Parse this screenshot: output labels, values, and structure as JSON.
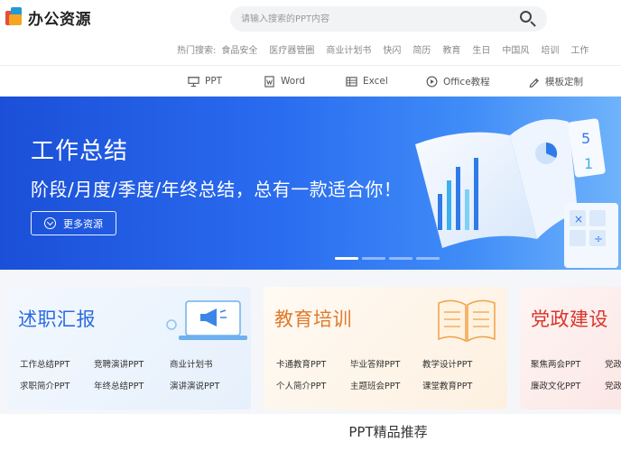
{
  "header": {
    "logo_text": "办公资源",
    "search": {
      "placeholder": "请输入搜索的PPT内容"
    },
    "hot_label": "热门搜索:",
    "hot_items": [
      "食品安全",
      "医疗器管圈",
      "商业计划书",
      "快闪",
      "简历",
      "教育",
      "生日",
      "中国风",
      "培训",
      "工作"
    ]
  },
  "nav": {
    "items": [
      {
        "label": "PPT",
        "icon": "presentation-icon"
      },
      {
        "label": "Word",
        "icon": "word-doc-icon"
      },
      {
        "label": "Excel",
        "icon": "spreadsheet-icon"
      },
      {
        "label": "Office教程",
        "icon": "play-circle-icon"
      },
      {
        "label": "模板定制",
        "icon": "pen-icon"
      }
    ]
  },
  "banner": {
    "title": "工作总结",
    "subtitle": "阶段/月度/季度/年终总结，总有一款适合你！",
    "button_label": "更多资源",
    "colors": {
      "start": "#1b4fd8",
      "end": "#6fb3fb"
    },
    "slide_count": 4,
    "active_slide": 1
  },
  "cards": [
    {
      "title": "述职汇报",
      "title_color": "#2a6be0",
      "bg": "#eaf2fd",
      "links": [
        "工作总结PPT",
        "竞聘演讲PPT",
        "商业计划书",
        "求职简介PPT",
        "年终总结PPT",
        "演讲演说PPT"
      ]
    },
    {
      "title": "教育培训",
      "title_color": "#e07a2a",
      "bg": "#fdf1e4",
      "links": [
        "卡通教育PPT",
        "毕业答辩PPT",
        "教学设计PPT",
        "个人简介PPT",
        "主题班会PPT",
        "课堂教育PPT"
      ]
    },
    {
      "title": "党政建设",
      "title_color": "#d9342b",
      "bg": "#fdebea",
      "links": [
        "聚焦两会PPT",
        "党政",
        "廉政文化PPT",
        "党政"
      ]
    }
  ],
  "section": {
    "title": "PPT精品推荐"
  }
}
